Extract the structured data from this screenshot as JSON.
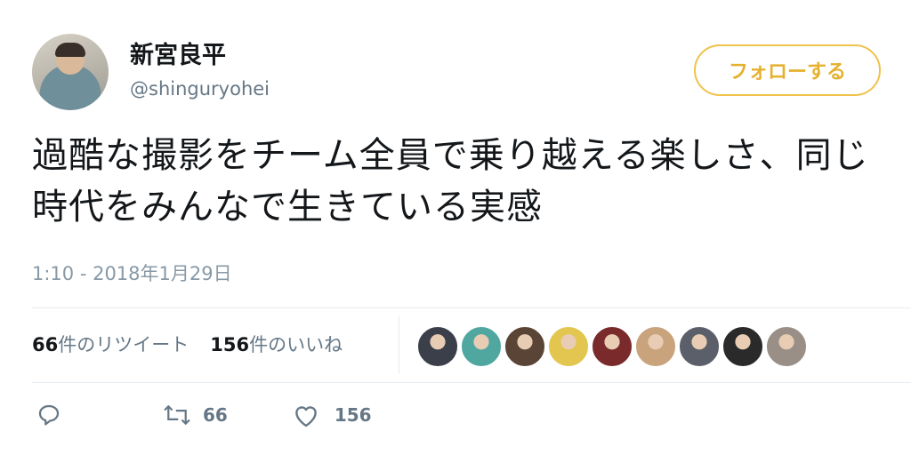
{
  "user": {
    "display_name": "新宮良平",
    "handle": "@shinguryohei"
  },
  "follow_button": "フォローする",
  "tweet": {
    "text": "過酷な撮影をチーム全員で乗り越える楽しさ、同じ時代をみんなで生きている実感",
    "timestamp": "1:10 - 2018年1月29日"
  },
  "stats": {
    "retweets_count": "66",
    "retweets_label": "件のリツイート",
    "likes_count": "156",
    "likes_label": "件のいいね"
  },
  "liker_avatar_colors": [
    "#3b3f4a",
    "#4fa7a0",
    "#5a4436",
    "#e2c64f",
    "#7a2a2a",
    "#c9a37c",
    "#5b5f6a",
    "#2a2a2a",
    "#9a8f86"
  ],
  "actions": {
    "reply_icon": "reply-icon",
    "retweet_icon": "retweet-icon",
    "retweet_count": "66",
    "like_icon": "heart-icon",
    "like_count": "156"
  },
  "colors": {
    "follow_accent": "#f0c24b",
    "secondary_text": "#657786"
  }
}
